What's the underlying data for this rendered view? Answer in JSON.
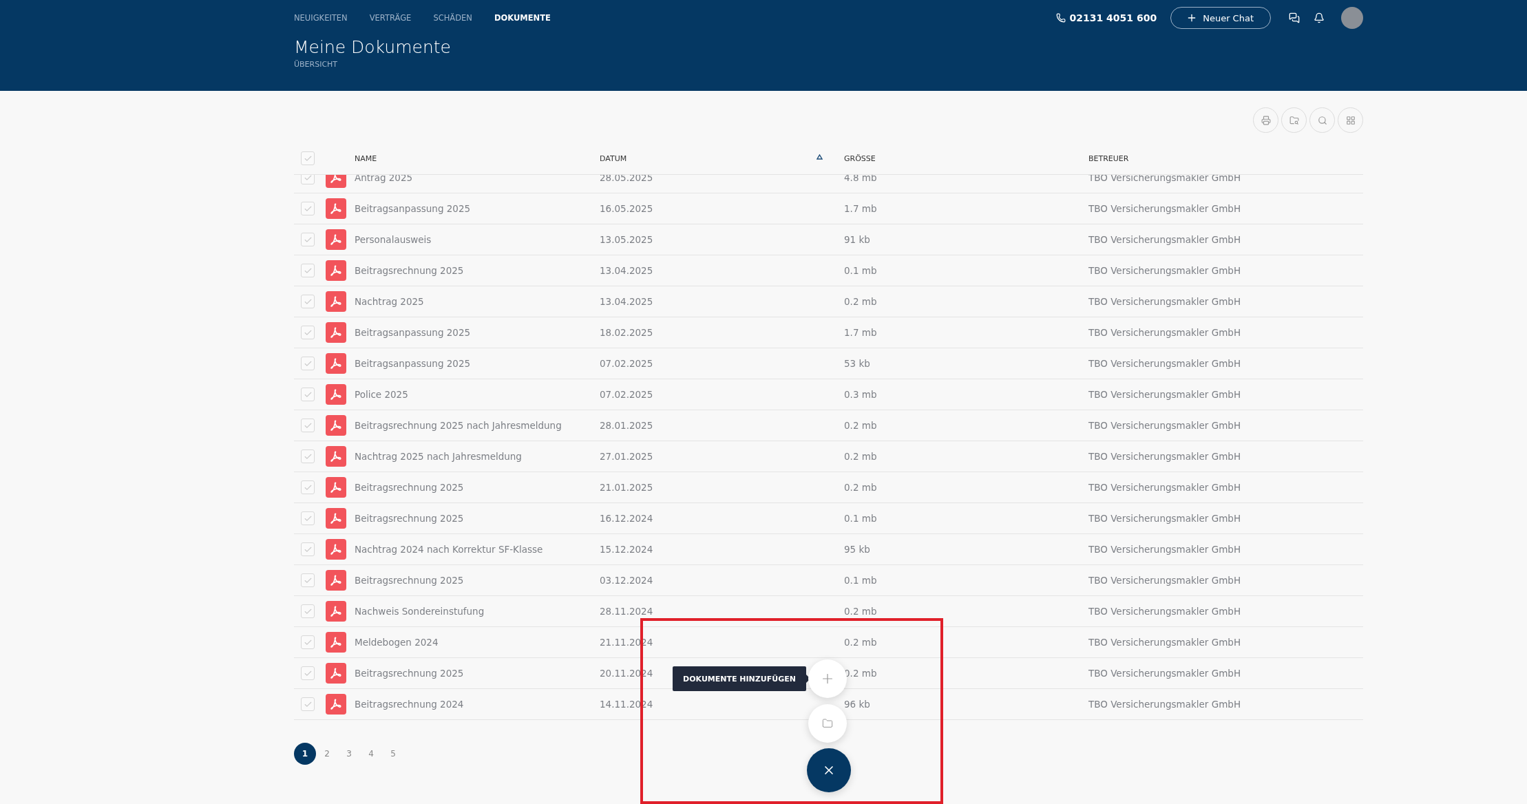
{
  "nav": [
    {
      "label": "NEUIGKEITEN",
      "selected": false
    },
    {
      "label": "VERTRÄGE",
      "selected": false
    },
    {
      "label": "SCHÄDEN",
      "selected": false
    },
    {
      "label": "DOKUMENTE",
      "selected": true
    }
  ],
  "phone": "02131 4051 600",
  "new_chat_button": "Neuer Chat",
  "page_title": "Meine Dokumente",
  "page_subtitle": "ÜBERSICHT",
  "table": {
    "select_all_checked": false,
    "columns": [
      {
        "label": "NAME",
        "sorted": false
      },
      {
        "label": "DATUM",
        "sorted": true
      },
      {
        "label": "GRÖSSE",
        "sorted": false
      },
      {
        "label": "BETREUER",
        "sorted": false
      }
    ],
    "rows": [
      {
        "name": "Antrag 2025",
        "date": "28.05.2025",
        "size": "4.8 mb",
        "advisor": "TBO Versicherungsmakler GmbH",
        "checked": false
      },
      {
        "name": "Beitragsanpassung 2025",
        "date": "16.05.2025",
        "size": "1.7 mb",
        "advisor": "TBO Versicherungsmakler GmbH",
        "checked": false
      },
      {
        "name": "Personalausweis",
        "date": "13.05.2025",
        "size": "91 kb",
        "advisor": "TBO Versicherungsmakler GmbH",
        "checked": false
      },
      {
        "name": "Beitragsrechnung 2025",
        "date": "13.04.2025",
        "size": "0.1 mb",
        "advisor": "TBO Versicherungsmakler GmbH",
        "checked": false
      },
      {
        "name": "Nachtrag 2025",
        "date": "13.04.2025",
        "size": "0.2 mb",
        "advisor": "TBO Versicherungsmakler GmbH",
        "checked": false
      },
      {
        "name": "Beitragsanpassung 2025",
        "date": "18.02.2025",
        "size": "1.7 mb",
        "advisor": "TBO Versicherungsmakler GmbH",
        "checked": false
      },
      {
        "name": "Beitragsanpassung 2025",
        "date": "07.02.2025",
        "size": "53 kb",
        "advisor": "TBO Versicherungsmakler GmbH",
        "checked": false
      },
      {
        "name": "Police 2025",
        "date": "07.02.2025",
        "size": "0.3 mb",
        "advisor": "TBO Versicherungsmakler GmbH",
        "checked": false
      },
      {
        "name": "Beitragsrechnung 2025 nach Jahresmeldung",
        "date": "28.01.2025",
        "size": "0.2 mb",
        "advisor": "TBO Versicherungsmakler GmbH",
        "checked": false
      },
      {
        "name": "Nachtrag 2025 nach Jahresmeldung",
        "date": "27.01.2025",
        "size": "0.2 mb",
        "advisor": "TBO Versicherungsmakler GmbH",
        "checked": false
      },
      {
        "name": "Beitragsrechnung 2025",
        "date": "21.01.2025",
        "size": "0.2 mb",
        "advisor": "TBO Versicherungsmakler GmbH",
        "checked": false
      },
      {
        "name": "Beitragsrechnung 2025",
        "date": "16.12.2024",
        "size": "0.1 mb",
        "advisor": "TBO Versicherungsmakler GmbH",
        "checked": false
      },
      {
        "name": "Nachtrag 2024 nach Korrektur SF-Klasse",
        "date": "15.12.2024",
        "size": "95 kb",
        "advisor": "TBO Versicherungsmakler GmbH",
        "checked": false
      },
      {
        "name": "Beitragsrechnung 2025",
        "date": "03.12.2024",
        "size": "0.1 mb",
        "advisor": "TBO Versicherungsmakler GmbH",
        "checked": false
      },
      {
        "name": "Nachweis Sondereinstufung",
        "date": "28.11.2024",
        "size": "0.2 mb",
        "advisor": "TBO Versicherungsmakler GmbH",
        "checked": false
      },
      {
        "name": "Meldebogen 2024",
        "date": "21.11.2024",
        "size": "0.2 mb",
        "advisor": "TBO Versicherungsmakler GmbH",
        "checked": false
      },
      {
        "name": "Beitragsrechnung 2025",
        "date": "20.11.2024",
        "size": "0.2 mb",
        "advisor": "TBO Versicherungsmakler GmbH",
        "checked": false
      },
      {
        "name": "Beitragsrechnung 2024",
        "date": "14.11.2024",
        "size": "96 kb",
        "advisor": "TBO Versicherungsmakler GmbH",
        "checked": false
      }
    ]
  },
  "pagination": [
    {
      "label": "1",
      "selected": true
    },
    {
      "label": "2",
      "selected": false
    },
    {
      "label": "3",
      "selected": false
    },
    {
      "label": "4",
      "selected": false
    },
    {
      "label": "5",
      "selected": false
    }
  ],
  "fab_tooltip": "DOKUMENTE HINZUFÜGEN"
}
